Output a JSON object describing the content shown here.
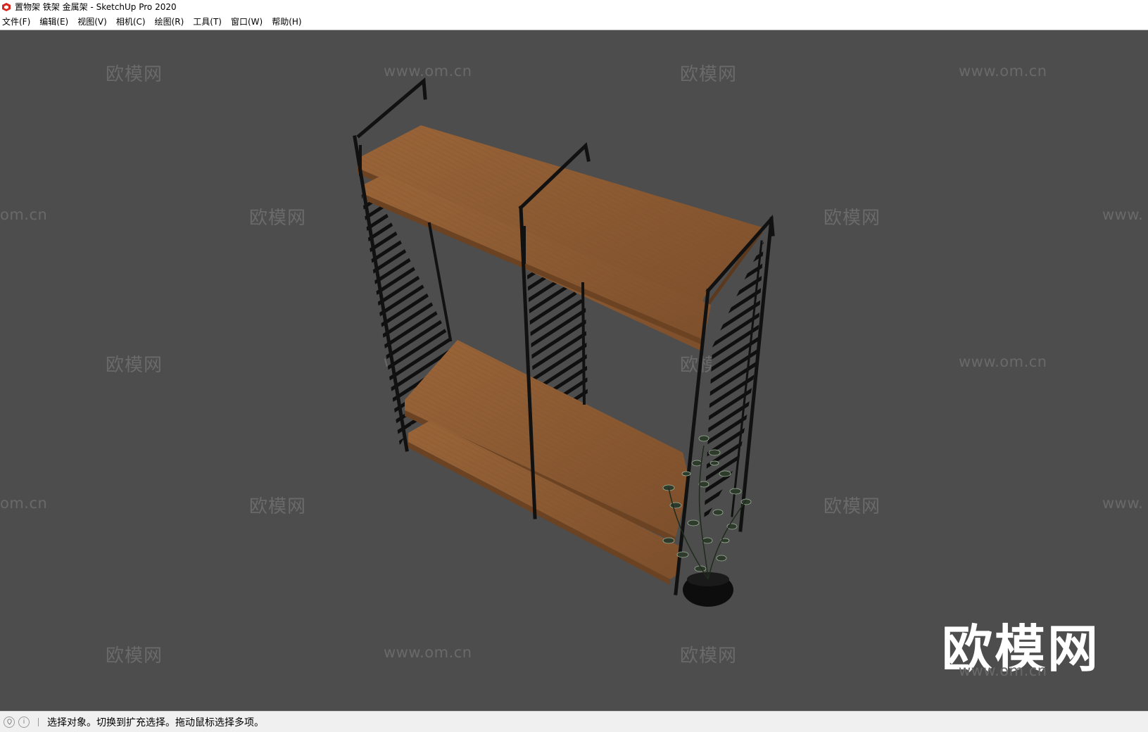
{
  "window": {
    "title": "置物架 铁架 金属架 - SketchUp Pro 2020",
    "icon": "sketchup-logo-icon"
  },
  "menu": [
    {
      "label": "文件(F)"
    },
    {
      "label": "编辑(E)"
    },
    {
      "label": "视图(V)"
    },
    {
      "label": "相机(C)"
    },
    {
      "label": "绘图(R)"
    },
    {
      "label": "工具(T)"
    },
    {
      "label": "窗口(W)"
    },
    {
      "label": "帮助(H)"
    }
  ],
  "viewport": {
    "background": "#4d4d4d",
    "model": "shelf-with-plant"
  },
  "watermark": {
    "brand": "欧模网",
    "url": "www.om.cn",
    "url_fragment_left": "om.cn",
    "url_fragment_right": "www."
  },
  "statusbar": {
    "text": "选择对象。切换到扩充选择。拖动鼠标选择多项。",
    "icons": [
      "geolocation-icon",
      "info-icon"
    ]
  },
  "colors": {
    "wood": "#8b5a32",
    "wood_edge": "#6b4222",
    "metal": "#111111",
    "accent_logo": "#d9261c"
  }
}
